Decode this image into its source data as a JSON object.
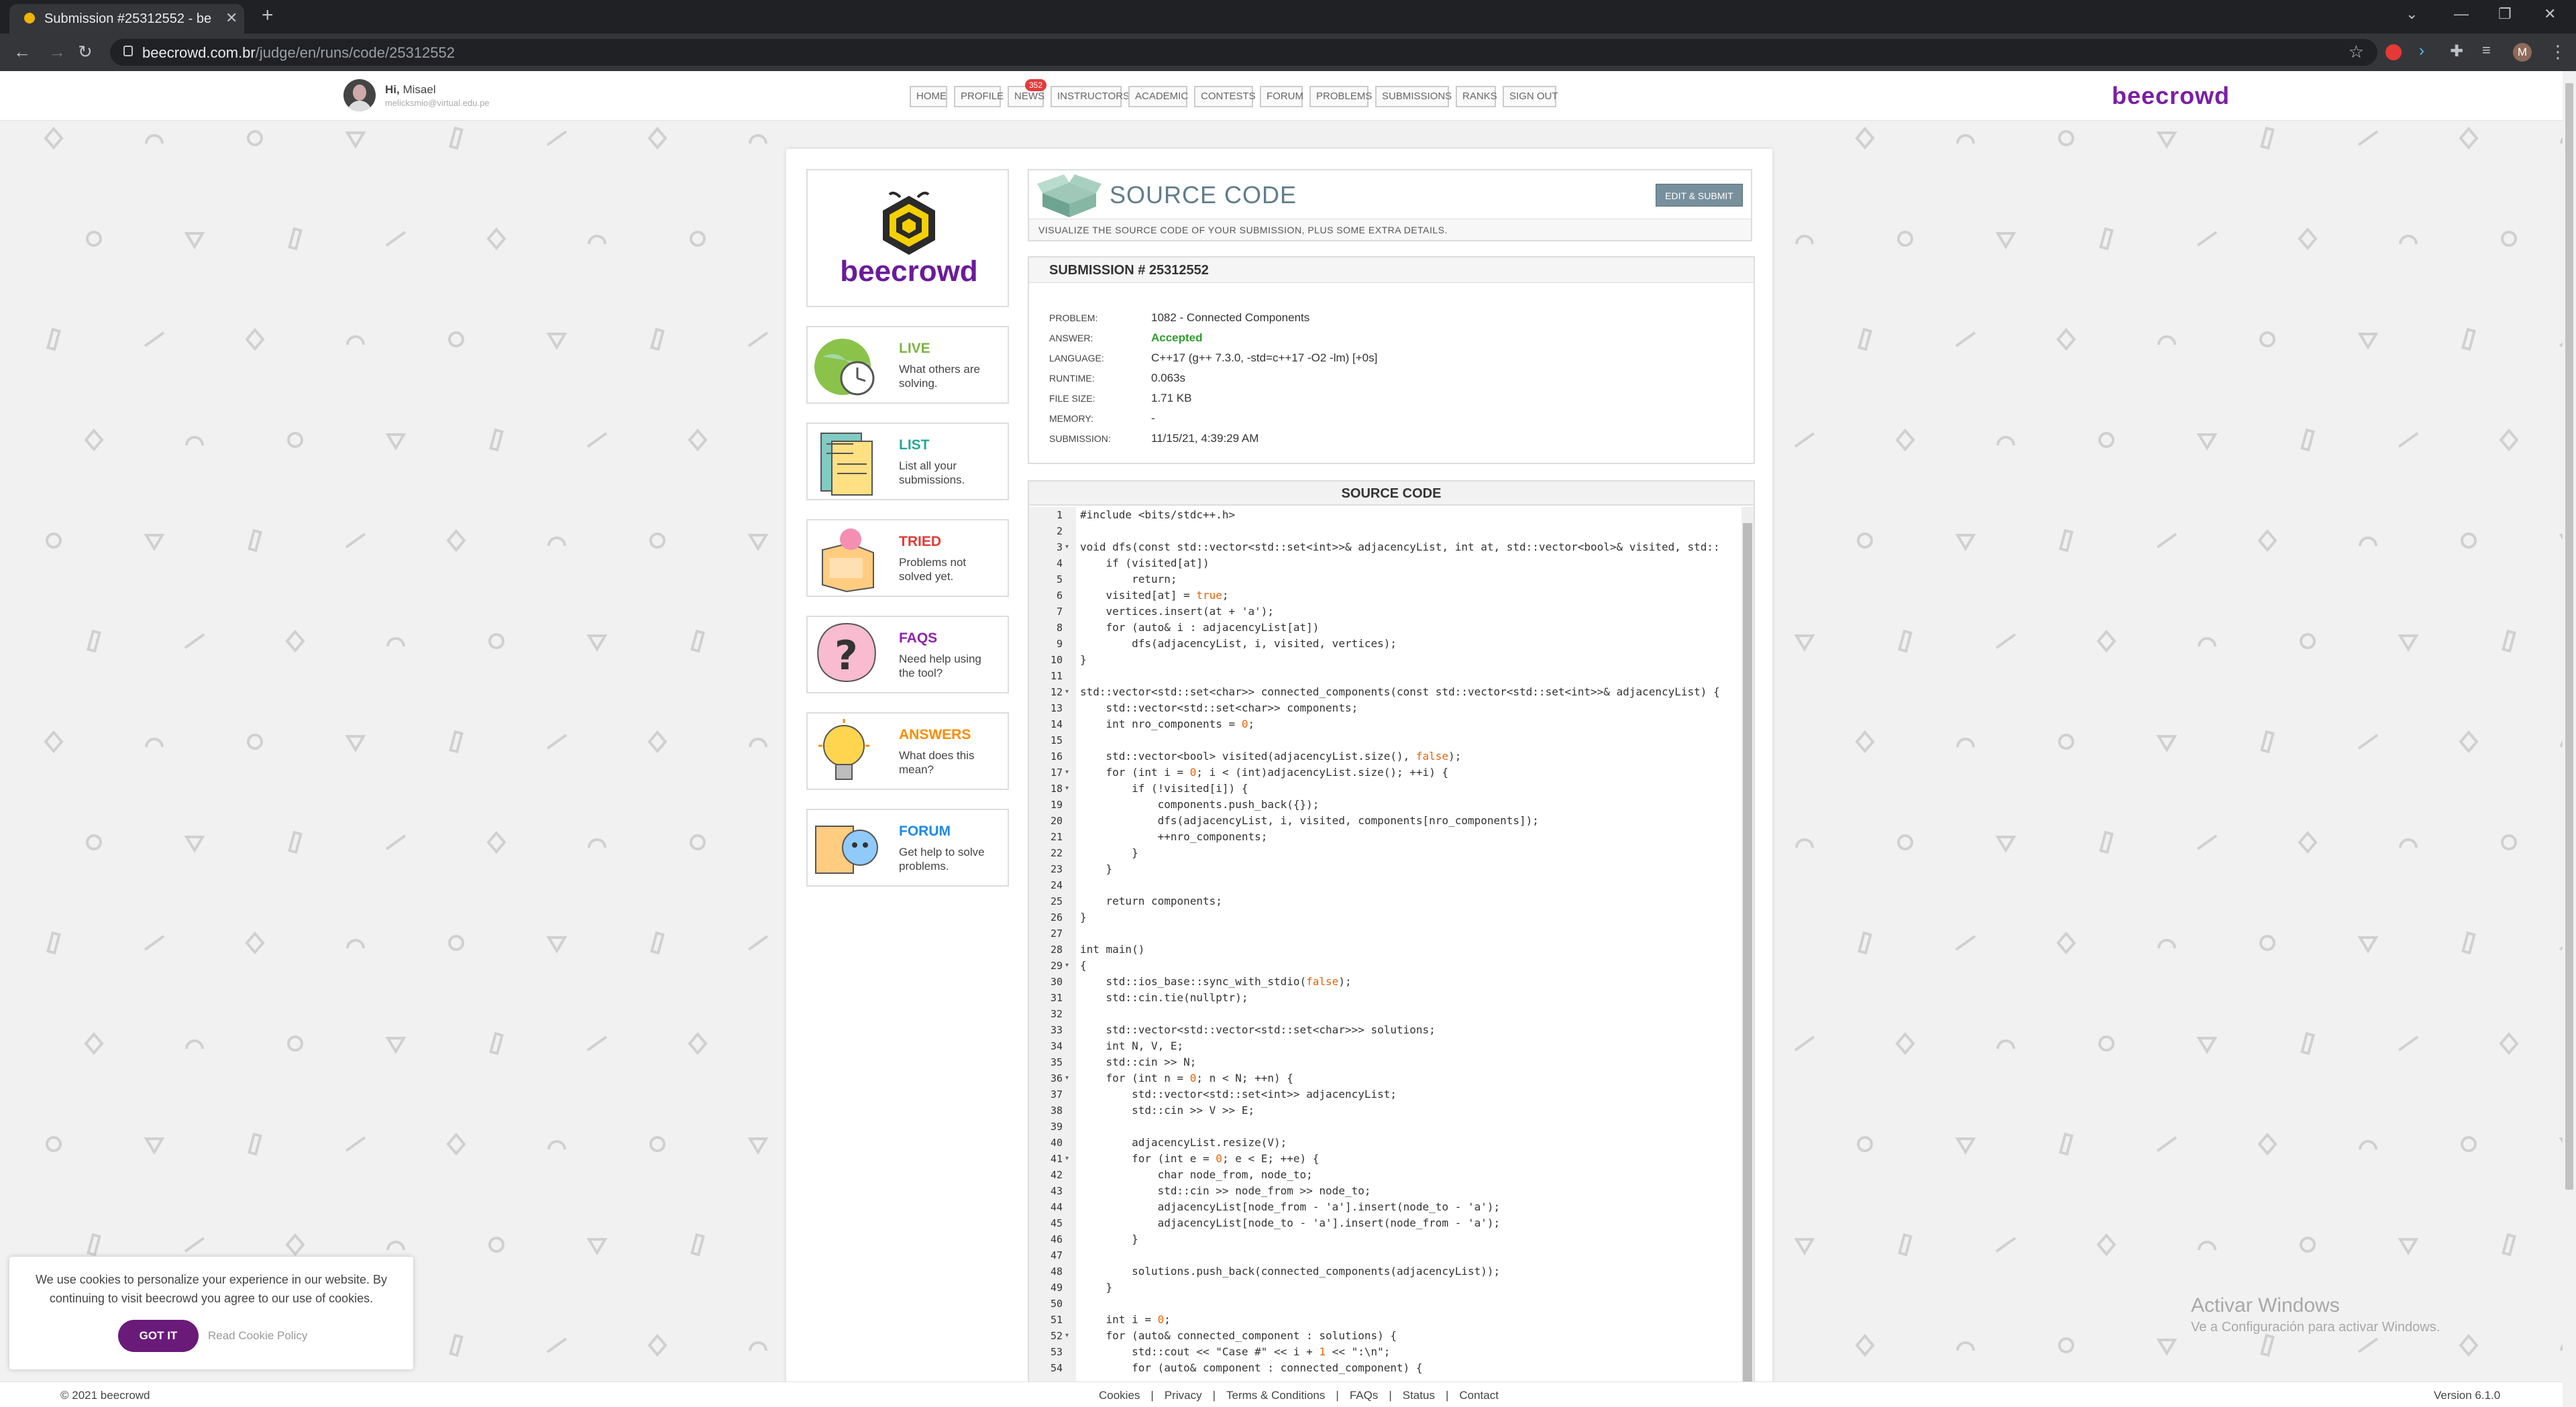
{
  "browser": {
    "tab_title": "Submission #25312552 - beecrowd",
    "url_host": "beecrowd.com.br",
    "url_path": "/judge/en/runs/code/25312552",
    "profile_letter": "M"
  },
  "header": {
    "greeting": "Hi,",
    "username": "Misael",
    "email": "melicksmio@virtual.edu.pe",
    "brand": "beecrowd"
  },
  "nav": [
    {
      "label": "HOME"
    },
    {
      "label": "PROFILE"
    },
    {
      "label": "NEWS",
      "badge": "352"
    },
    {
      "label": "INSTRUCTORS"
    },
    {
      "label": "ACADEMIC"
    },
    {
      "label": "CONTESTS"
    },
    {
      "label": "FORUM"
    },
    {
      "label": "PROBLEMS"
    },
    {
      "label": "SUBMISSIONS"
    },
    {
      "label": "RANKS"
    },
    {
      "label": "SIGN OUT"
    }
  ],
  "logo_text": "beecrowd",
  "sidebar": [
    {
      "title": "LIVE",
      "desc": "What others are solving.",
      "color": "#7cb342"
    },
    {
      "title": "LIST",
      "desc": "List all your submissions.",
      "color": "#26a69a"
    },
    {
      "title": "TRIED",
      "desc": "Problems not solved yet.",
      "color": "#e53935"
    },
    {
      "title": "FAQS",
      "desc": "Need help using the tool?",
      "color": "#8e24aa"
    },
    {
      "title": "ANSWERS",
      "desc": "What does this mean?",
      "color": "#fb8c00"
    },
    {
      "title": "FORUM",
      "desc": "Get help to solve problems.",
      "color": "#1e88e5"
    }
  ],
  "source_header": {
    "title": "SOURCE CODE",
    "edit_button": "EDIT & SUBMIT",
    "subtitle": "VISUALIZE THE SOURCE CODE OF YOUR SUBMISSION, PLUS SOME EXTRA DETAILS."
  },
  "submission": {
    "heading": "SUBMISSION # 25312552",
    "rows": [
      {
        "label": "PROBLEM:",
        "value": "1082 - Connected Components"
      },
      {
        "label": "ANSWER:",
        "value": "Accepted"
      },
      {
        "label": "LANGUAGE:",
        "value": "C++17 (g++ 7.3.0, -std=c++17 -O2 -lm) [+0s]"
      },
      {
        "label": "RUNTIME:",
        "value": "0.063s"
      },
      {
        "label": "FILE SIZE:",
        "value": "1.71 KB"
      },
      {
        "label": "MEMORY:",
        "value": "-"
      },
      {
        "label": "SUBMISSION:",
        "value": "11/15/21, 4:39:29 AM"
      }
    ]
  },
  "code": {
    "heading": "SOURCE CODE",
    "fold_lines": [
      3,
      12,
      17,
      18,
      29,
      36,
      41,
      52
    ],
    "lines": [
      "#include <bits/stdc++.h>",
      "",
      "void dfs(const std::vector<std::set<int>>& adjacencyList, int at, std::vector<bool>& visited, std::",
      "    if (visited[at])",
      "        return;",
      "    visited[at] = true;",
      "    vertices.insert(at + 'a');",
      "    for (auto& i : adjacencyList[at])",
      "        dfs(adjacencyList, i, visited, vertices);",
      "}",
      "",
      "std::vector<std::set<char>> connected_components(const std::vector<std::set<int>>& adjacencyList) {",
      "    std::vector<std::set<char>> components;",
      "    int nro_components = 0;",
      "",
      "    std::vector<bool> visited(adjacencyList.size(), false);",
      "    for (int i = 0; i < (int)adjacencyList.size(); ++i) {",
      "        if (!visited[i]) {",
      "            components.push_back({});",
      "            dfs(adjacencyList, i, visited, components[nro_components]);",
      "            ++nro_components;",
      "        }",
      "    }",
      "",
      "    return components;",
      "}",
      "",
      "int main()",
      "{",
      "    std::ios_base::sync_with_stdio(false);",
      "    std::cin.tie(nullptr);",
      "",
      "    std::vector<std::vector<std::set<char>>> solutions;",
      "    int N, V, E;",
      "    std::cin >> N;",
      "    for (int n = 0; n < N; ++n) {",
      "        std::vector<std::set<int>> adjacencyList;",
      "        std::cin >> V >> E;",
      "",
      "        adjacencyList.resize(V);",
      "        for (int e = 0; e < E; ++e) {",
      "            char node_from, node_to;",
      "            std::cin >> node_from >> node_to;",
      "            adjacencyList[node_from - 'a'].insert(node_to - 'a');",
      "            adjacencyList[node_to - 'a'].insert(node_from - 'a');",
      "        }",
      "",
      "        solutions.push_back(connected_components(adjacencyList));",
      "    }",
      "",
      "    int i = 0;",
      "    for (auto& connected_component : solutions) {",
      "        std::cout << \"Case #\" << i + 1 << \":\\n\";",
      "        for (auto& component : connected_component) {"
    ]
  },
  "cookie": {
    "text": "We use cookies to personalize your experience in our website. By continuing to visit beecrowd you agree to our use of cookies.",
    "button": "GOT IT",
    "policy": "Read Cookie Policy"
  },
  "watermark": {
    "line1": "Activar Windows",
    "line2": "Ve a Configuración para activar Windows."
  },
  "footer": {
    "copyright": "© 2021 beecrowd",
    "links": [
      "Cookies",
      "Privacy",
      "Terms & Conditions",
      "FAQs",
      "Status",
      "Contact"
    ],
    "version": "Version 6.1.0"
  }
}
